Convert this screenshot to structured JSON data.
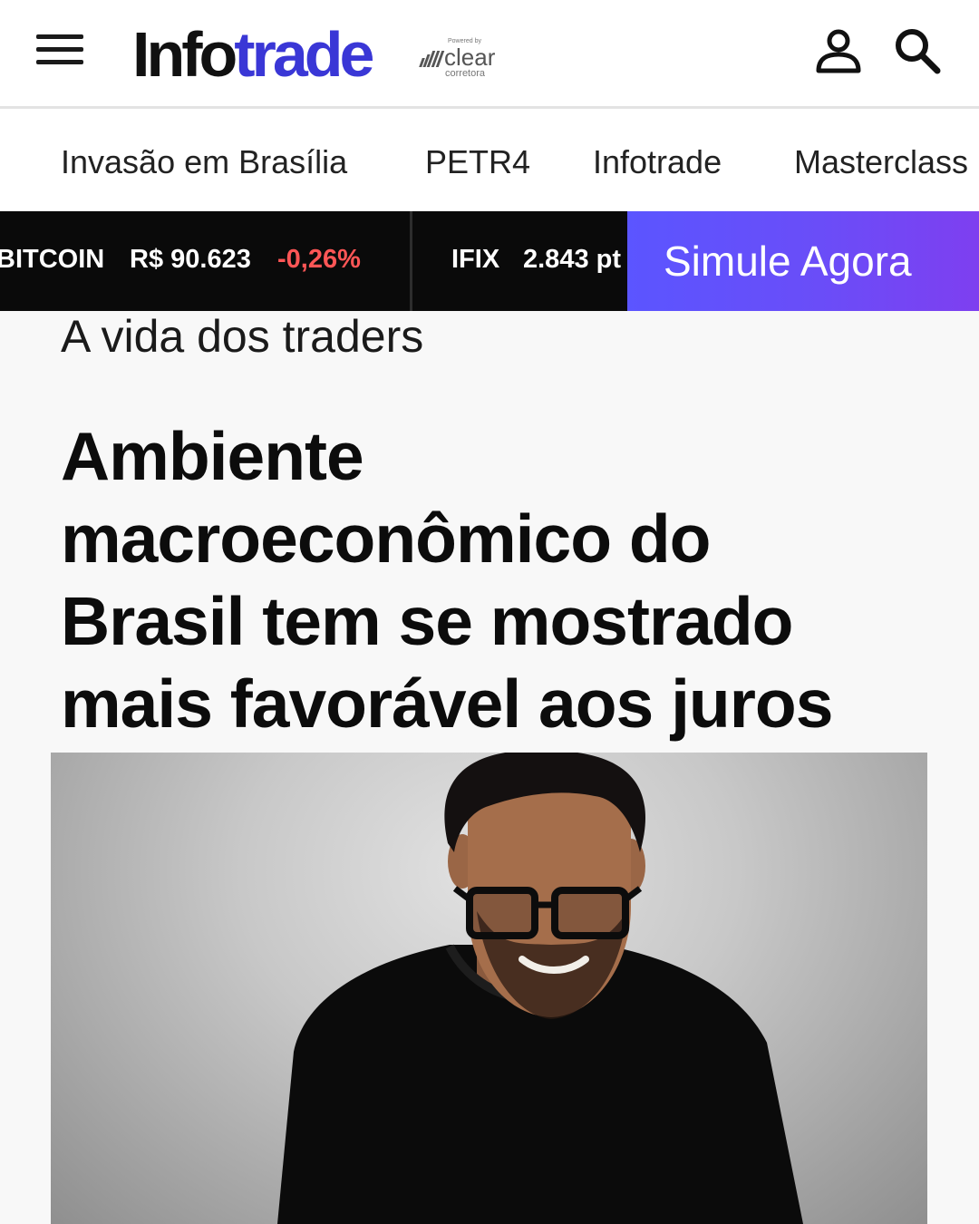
{
  "header": {
    "logo_part1": "Info",
    "logo_part2": "trade",
    "powered_by": "Powered by",
    "partner_name": "clear",
    "partner_sub": "corretora"
  },
  "nav": {
    "items": [
      {
        "label": "Invasão em Brasília"
      },
      {
        "label": "PETR4"
      },
      {
        "label": "Infotrade"
      },
      {
        "label": "Masterclass"
      }
    ]
  },
  "ticker": {
    "items": [
      {
        "name": "BITCOIN",
        "value": "R$ 90.623",
        "change": "-0,26%"
      },
      {
        "name": "IFIX",
        "value": "2.843 pt"
      }
    ],
    "cta_label": "Simule Agora"
  },
  "article": {
    "section": "A vida dos traders",
    "headline_lines": [
      "Ambiente",
      "macroeconômico do",
      "Brasil tem se mostrado",
      "mais favorável aos juros"
    ]
  },
  "icons": [
    "menu-icon",
    "user-icon",
    "search-icon"
  ],
  "colors": {
    "brand_blue": "#3a37d6",
    "cta_gradient_start": "#5b55ff",
    "cta_gradient_end": "#7e3ff0",
    "ticker_bg": "#0a0a0a",
    "negative": "#ff5656"
  }
}
